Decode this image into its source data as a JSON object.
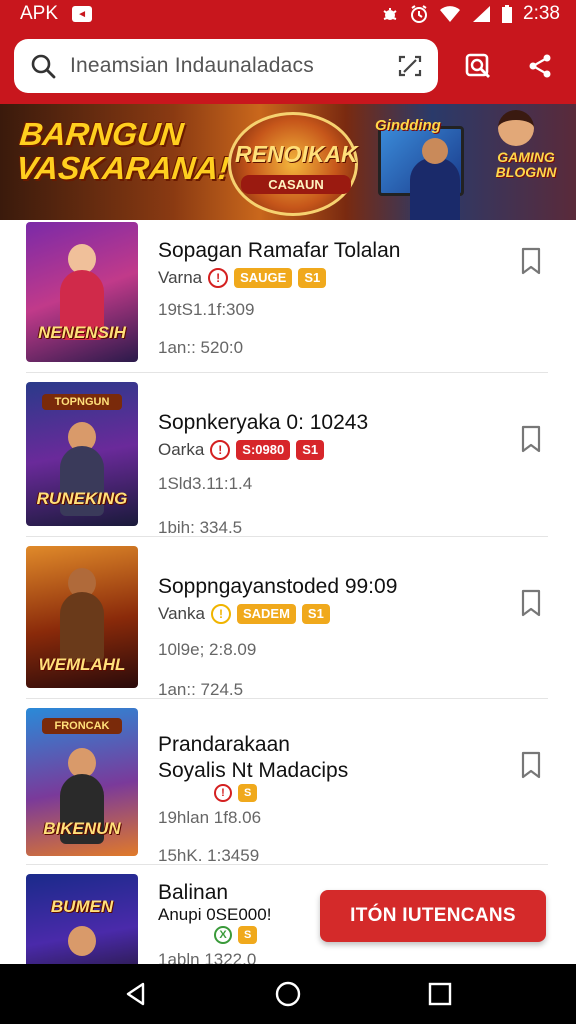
{
  "status_bar": {
    "app_label": "APK",
    "time": "2:38"
  },
  "search": {
    "placeholder": "Ineamsian Indaunaladacs"
  },
  "banner": {
    "left_line1": "BARNGUN",
    "left_line2": "VASKARANA!",
    "mid_text": "RENOIKAK",
    "mid_sub": "CASAUN",
    "screen_logo": "Gindding",
    "right_text": "GAMING BLOGNN"
  },
  "items": [
    {
      "thumb_caption": "NENENSIH",
      "title": "Sopagan Ramafar Tolalan",
      "meta_label": "Varna",
      "meta_icon": "!",
      "meta_icon_color": "red",
      "badges": [
        "SAUGE",
        "S1"
      ],
      "badge_colors": [
        "yellow",
        "yellow"
      ],
      "info1": "19tS1.1f:309",
      "info2": "1an:: 520:0"
    },
    {
      "thumb_caption": "RUNEKING",
      "thumb_top": "TOPNGUN",
      "title": "Sopnkeryaka 0: 10243",
      "meta_label": "Oarka",
      "meta_icon": "!",
      "meta_icon_color": "red",
      "badges": [
        "S:0980",
        "S1"
      ],
      "badge_colors": [
        "red",
        "red"
      ],
      "info1": "1Sld3.11:1.4",
      "info2": "1bih: 334.5"
    },
    {
      "thumb_caption": "WEMLAHL",
      "title": "Soppngayanstoded 99:09",
      "meta_label": "Vanka",
      "meta_icon": "!",
      "meta_icon_color": "yellow",
      "badges": [
        "SADEM",
        "S1"
      ],
      "badge_colors": [
        "yellow",
        "yellow"
      ],
      "info1": "10l9e; 2:8.09",
      "info2": "1an:: 724.5"
    },
    {
      "thumb_caption": "BIKENUN",
      "thumb_top": "FRONCAK",
      "title_line1": "Prandarakaan",
      "title_line2": "Soyalis Nt Madacips",
      "meta_icon": "!",
      "meta_icon_color": "red",
      "badges": [
        "S"
      ],
      "badge_colors": [
        "yellow"
      ],
      "info1": "19hlan 1f8.06",
      "info2": "15hK. 1:3459"
    },
    {
      "thumb_caption": "BUMEN",
      "title_line1": "Balinan",
      "title_line2": "Anupi 0SE000!",
      "meta_icon": "X",
      "meta_icon_color": "green",
      "badges": [
        "S"
      ],
      "badge_colors": [
        "yellow"
      ],
      "info1": "1abln 1322.0"
    }
  ],
  "cta": {
    "label": "ITÓN IUTENCANS"
  },
  "colors": {
    "primary": "#c8161d",
    "cta": "#d42a2a",
    "badge_yellow": "#f0a91c",
    "badge_red": "#d7262a"
  }
}
